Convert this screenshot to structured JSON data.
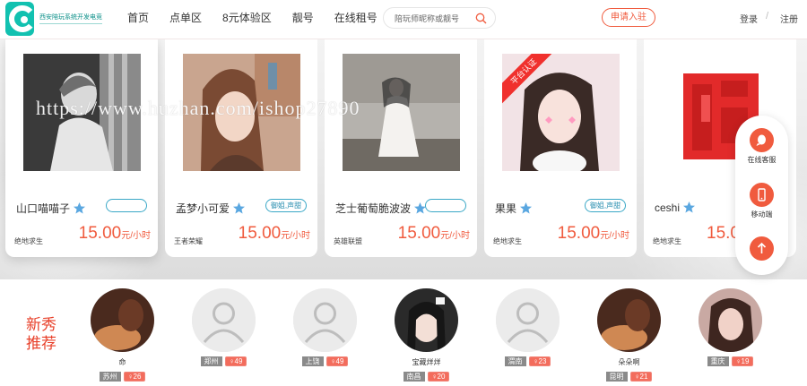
{
  "header": {
    "logo_text": "西安陪玩系统开发电竞",
    "nav": [
      "首页",
      "点单区",
      "8元体验区",
      "靓号",
      "在线租号"
    ],
    "search_placeholder": "陪玩师昵称或靓号",
    "apply_label": "申请入驻",
    "login_label": "登录",
    "separator": "/",
    "register_label": "注册"
  },
  "watermark": "https://www.huzhan.com/ishop27890",
  "cards": [
    {
      "name": "山口喵喵子",
      "tag": "",
      "game": "绝地求生",
      "price": "15.00",
      "unit": "元/小时",
      "official": ""
    },
    {
      "name": "孟梦小可爱",
      "tag": "御姐,声甜",
      "game": "王者荣耀",
      "price": "15.00",
      "unit": "元/小时",
      "official": ""
    },
    {
      "name": "芝士葡萄脆波波",
      "tag": "",
      "game": "英雄联盟",
      "price": "15.00",
      "unit": "元/小时",
      "official": ""
    },
    {
      "name": "果果",
      "tag": "御姐,声甜",
      "game": "绝地求生",
      "price": "15.00",
      "unit": "元/小时",
      "official": "平台认证"
    },
    {
      "name": "ceshi",
      "tag": "",
      "game": "绝地求生",
      "price": "15.0",
      "unit": "",
      "official": ""
    }
  ],
  "floatbar": {
    "service_label": "在线客服",
    "mobile_label": "移动端"
  },
  "new_section": {
    "title": "新秀推荐",
    "players": [
      {
        "name": "命",
        "city": "苏州",
        "sex": "♀26"
      },
      {
        "name": "",
        "city": "郑州",
        "sex": "♀49"
      },
      {
        "name": "",
        "city": "上饶",
        "sex": "♀49"
      },
      {
        "name": "宝藏烊烊",
        "city": "南昌",
        "sex": "♀20"
      },
      {
        "name": "",
        "city": "渭南",
        "sex": "♀23"
      },
      {
        "name": "朵朵啊",
        "city": "昆明",
        "sex": "♀21"
      },
      {
        "name": "",
        "city": "重庆",
        "sex": "♀19"
      }
    ]
  },
  "colors": {
    "accent": "#f05b3e",
    "logo": "#12c1b0",
    "tag_blue": "#3aa8c7"
  }
}
